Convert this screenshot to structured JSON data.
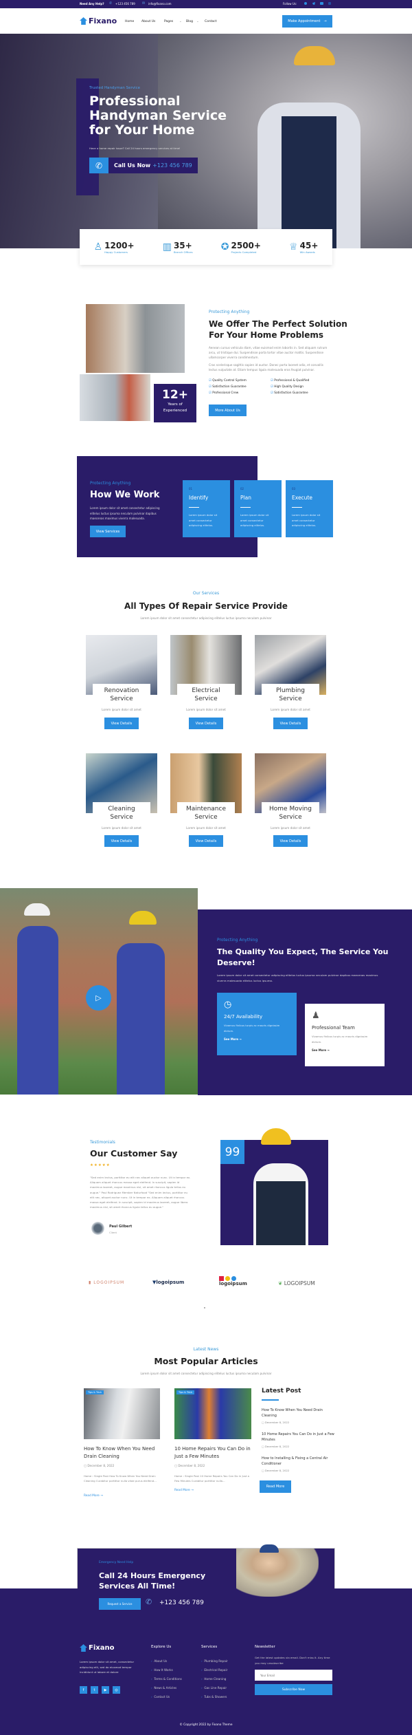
{
  "topbar": {
    "help": "Need Any Help?",
    "phone": "+123 456 789",
    "email": "info@fixano.com",
    "follow": "Follow Us:"
  },
  "nav": {
    "brand": "Fixano",
    "items": [
      "Home",
      "About Us",
      "Pages",
      "Blog",
      "Contact"
    ],
    "cta": "Make Appointment"
  },
  "hero": {
    "kicker": "Trusted Handyman Service",
    "title_lines": [
      "Professional",
      "Handyman Service",
      "for Your Home"
    ],
    "subtitle": "Have a home repair issue? Call 24 hours emergency services at time!",
    "call_label": "Call Us Now",
    "call_number": "+123 456 789"
  },
  "stats": [
    {
      "value": "1200+",
      "label": "Happy Customers",
      "icon": "customers-icon"
    },
    {
      "value": "35+",
      "label": "Branch Offices",
      "icon": "building-icon"
    },
    {
      "value": "2500+",
      "label": "Projects Completed",
      "icon": "badge-icon"
    },
    {
      "value": "45+",
      "label": "Win Awards",
      "icon": "trophy-icon"
    }
  ],
  "about": {
    "kicker": "Protecting Anything",
    "title_lines": [
      "We Offer The Perfect Solution",
      "For Your Home Problems"
    ],
    "p1": "Aenean cursus vehicula diam, vitae euismod enim lobortis in. Sed aliquam rutrum arcu, ut tristique dui. Suspendisse porta tortor vitae auctor mattis. Suspendisse ullamcorper viverra condimentum.",
    "p2": "Cras scelerisque sagittis sapien id auctor. Donec porta laoreet odio, et convallis lectus vulputate at. Etiam tempus ligula malesuada eros feugiat pulvinar.",
    "checks": [
      "Quality Control System",
      "Professional & Qualified",
      "Satisfaction Guarantee",
      "High Quality Design",
      "Professional Crew",
      "Satisfaction Guarantee"
    ],
    "button": "More About Us",
    "years_value": "12+",
    "years_label_1": "Years of",
    "years_label_2": "Experienced"
  },
  "work": {
    "kicker": "Protecting Anything",
    "title": "How We Work",
    "text": "Lorem ipsum dolor sit amet consectetur adipiscing elitelus luctus ipsuma neculam pulvinar dapibus maecenas maximus viverra malesuada.",
    "button": "View Services",
    "steps": [
      {
        "num": "01",
        "title": "Identify",
        "text": "Lorem ipsum dolor sit amet consectetur adipiscing elitelus."
      },
      {
        "num": "02",
        "title": "Plan",
        "text": "Lorem ipsum dolor sit amet consectetur adipiscing elitelus."
      },
      {
        "num": "03",
        "title": "Execute",
        "text": "Lorem ipsum dolor sit amet consectetur adipiscing elitelus."
      }
    ]
  },
  "services": {
    "kicker": "Our Services",
    "title": "All Types Of Repair Service Provide",
    "subtitle": "Lorem ipsum dolor sit amet consectetur adipiscing elitelus luctus ipsuma neculam pulvinar",
    "items": [
      {
        "t1": "Renovation",
        "t2": "Service",
        "desc": "Lorem ipsum dolor sit amet",
        "button": "View Details"
      },
      {
        "t1": "Electrical",
        "t2": "Service",
        "desc": "Lorem ipsum dolor sit amet",
        "button": "View Details"
      },
      {
        "t1": "Plumbing",
        "t2": "Service",
        "desc": "Lorem ipsum dolor sit amet",
        "button": "View Details"
      },
      {
        "t1": "Cleaning",
        "t2": "Service",
        "desc": "Lorem ipsum dolor sit amet",
        "button": "View Details"
      },
      {
        "t1": "Maintenance",
        "t2": "Service",
        "desc": "Lorem ipsum dolor sit amet",
        "button": "View Details"
      },
      {
        "t1": "Home Moving",
        "t2": "Service",
        "desc": "Lorem ipsum dolor sit amet",
        "button": "View Details"
      }
    ]
  },
  "quality": {
    "kicker": "Protecting Anything",
    "title_lines": [
      "The Quality You Expect, The Service You",
      "Deserve!"
    ],
    "text": "Lorem ipsum dolor sit amet consectetur adipiscing elitelus luctus ipsuma neculam pulvinar dapibus maecenas maximus viverra malesuada elitelus luctus ipsuma.",
    "cards": [
      {
        "title": "24/7 Availability",
        "text": "Vivamus finibus turpis ac mauris dignissim dictum.",
        "link": "See More"
      },
      {
        "title": "Professional Team",
        "text": "Vivamus finibus turpis ac mauris dignissim dictum.",
        "link": "See More"
      }
    ]
  },
  "testimonial": {
    "kicker": "Testimonials",
    "title": "Our Customer Say",
    "rating": 5,
    "quote": "\"Sed enim lectus, porttitor eu elit nec aliquet auctor nunc. Ut in tempor ex. Aliquam aliquet rhoncus massa eget eleifend. In suscipit, sapien id maximus laoreet, augue maximus nisl, sit amet rhoncus ligula tellus eu augue.\" Paul Rodriguez Member Naturfood \"Sed enim lectus, porttitor eu elit nec, aliquet auctor nunc. Ut in tempor ex. Aliquam aliquet rhoncus massa eget eleifend. In suscipit, sapien id maximus laoreet, augue libero maximus nisl, sit amet rhoncus ligula tellus eu augue.\"",
    "name": "Paul Gilbert",
    "role": "Client",
    "quote_mark": "99"
  },
  "logos": [
    "LOGOIPSUM",
    "logoipsum",
    "logoipsum",
    "LOGOIPSUM"
  ],
  "articles": {
    "kicker": "Latest News",
    "title": "Most Popular Articles",
    "subtitle": "Lorem ipsum dolor sit amet consectetur adipiscing elitelus luctus ipsuma neculam pulvinar",
    "posts": [
      {
        "tag": "Tips & Trick",
        "title": "How To Know When You Need Drain Cleaning",
        "date": "December 8, 2022",
        "excerpt": "Home › Single Post How To Know When You Need Drain Cleaning Curabitur porttitor nulla vitae purus eleifend...",
        "link": "Read More"
      },
      {
        "tag": "Tips & Trick",
        "title": "10 Home Repairs You Can Do in Just a Few Minutes",
        "date": "December 8, 2022",
        "excerpt": "Home › Single Post 10 Home Repairs You Can Do in Just a Few Minutes Curabitur porttitor nulla...",
        "link": "Read More"
      }
    ],
    "latest_title": "Latest Post",
    "latest": [
      {
        "title": "How To Know When You Need Drain Cleaning",
        "date": "December 8, 2022"
      },
      {
        "title": "10 Home Repairs You Can Do in Just a Few Minutes",
        "date": "December 8, 2022"
      },
      {
        "title": "How to Installing & Fixing a Central Air Conditioner",
        "date": "December 8, 2022"
      }
    ],
    "latest_button": "Read More"
  },
  "emergency": {
    "kicker": "Emergency Need Help",
    "title_lines": [
      "Call 24 Hours Emergency",
      "Services All Time!"
    ],
    "button": "Request a Service",
    "phone": "+123 456 789"
  },
  "footer": {
    "brand": "Fixano",
    "about": "Lorem ipsum dolor sit amet, consectetur adipiscing elit, sed do eiusmod tempor incididunt ut labore et dolore",
    "explore_title": "Explore Us",
    "explore": [
      "About Us",
      "How It Works",
      "Terms & Conditions",
      "News & Articles",
      "Contact Us"
    ],
    "services_title": "Services",
    "services": [
      "Plumbing Repair",
      "Electrical Repair",
      "Home Cleaning",
      "Gas Line Repair",
      "Tubs & Showers"
    ],
    "newsletter_title": "Newsletter",
    "newsletter_text": "Get the latest updates via email. Don't miss it. Any time you may unsubscribe",
    "email_placeholder": "Your Email",
    "subscribe": "Subscribe Now",
    "copyright": "© Copyright 2022 by Fixano Theme"
  }
}
